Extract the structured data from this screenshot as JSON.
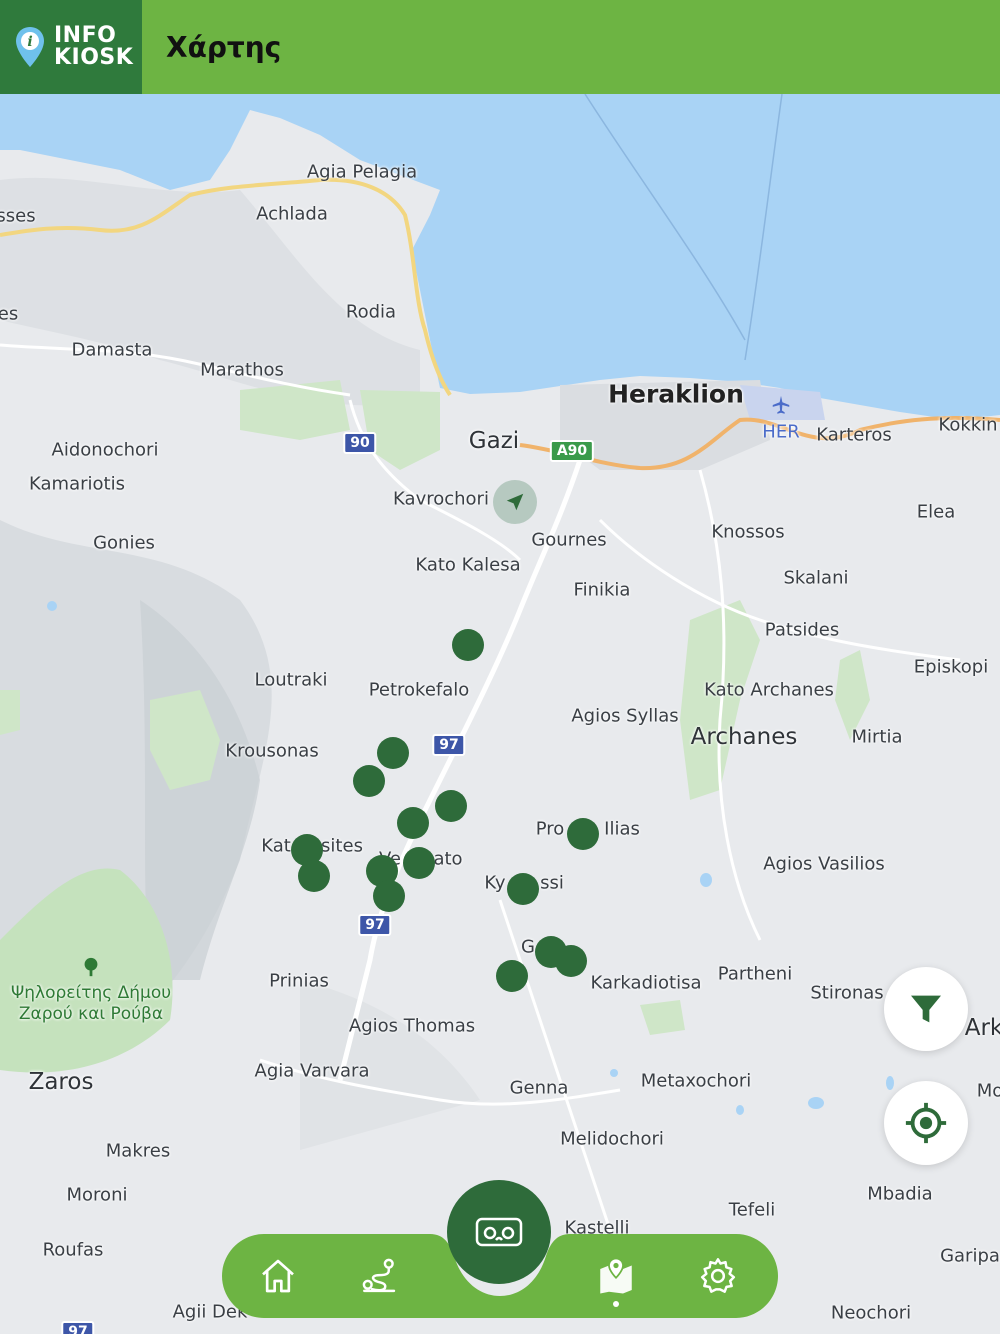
{
  "header": {
    "logo_line1": "INFO",
    "logo_line2": "KIOSK",
    "title": "Χάρτης"
  },
  "map": {
    "places": {
      "agia_pelagia": "Agia Pelagia",
      "achlada": "Achlada",
      "sses": "sses",
      "es": "es",
      "rodia": "Rodia",
      "damasta": "Damasta",
      "marathos": "Marathos",
      "heraklion": "Heraklion",
      "her": "HER",
      "karteros": "Karteros",
      "kokkini": "Kokkin",
      "aidonochori": "Aidonochori",
      "gazi": "Gazi",
      "kamariotis": "Kamariotis",
      "kavrochori": "Kavrochori",
      "elea": "Elea",
      "gournes": "Gournes",
      "knossos": "Knossos",
      "gonies": "Gonies",
      "kato_kalesa": "Kato Kalesa",
      "skalani": "Skalani",
      "finikia": "Finikia",
      "patsides": "Patsides",
      "episkopi": "Episkopi",
      "loutraki": "Loutraki",
      "petrokefalo": "Petrokefalo",
      "kato_archanes": "Kato Archanes",
      "agios_syllas": "Agios Syllas",
      "archanes": "Archanes",
      "mirtia": "Mirtia",
      "krousonas": "Krousonas",
      "prof_ilias_a": "Pro",
      "prof_ilias_b": "Ilias",
      "kat_sites_a": "Kat",
      "kat_sites_b": "sites",
      "ve_ato_a": "Ve",
      "ve_ato_b": "ato",
      "ky_ssi_a": "Ky",
      "ky_ssi_b": "ssi",
      "agios_vasilios": "Agios Vasilios",
      "g_label": "G",
      "karkadiotisa": "Karkadiotisa",
      "partheni": "Partheni",
      "stironas": "Stironas",
      "ark": "Ark",
      "prinias": "Prinias",
      "psiloreitis": "Ψηλορείτης Δήμου Ζαρού και Ρούβα",
      "agios_thomas": "Agios Thomas",
      "zaros": "Zaros",
      "agia_varvara": "Agia Varvara",
      "genna": "Genna",
      "metaxochori": "Metaxochori",
      "mo": "Mo",
      "melidochori": "Melidochori",
      "makres": "Makres",
      "moroni": "Moroni",
      "tefeli": "Tefeli",
      "mbadia": "Mbadia",
      "kastelli": "Kastelli",
      "roufas": "Roufas",
      "garipa": "Garipa",
      "agii_deka": "Agii Dek",
      "neochori": "Neochori"
    },
    "roads": {
      "r90": "90",
      "a90": "A90",
      "r97a": "97",
      "r97b": "97",
      "r97c": "97"
    }
  },
  "colors": {
    "header_green": "#6db443",
    "logo_green": "#2f7a3c",
    "poi_green": "#2e6b3a",
    "sea": "#a9d3f5"
  },
  "icons": {
    "filter": "filter-icon",
    "locate": "crosshair-icon",
    "home": "home-icon",
    "routes": "route-icon",
    "vr": "vr-headset-icon",
    "map": "map-pin-icon",
    "settings": "gear-icon"
  }
}
